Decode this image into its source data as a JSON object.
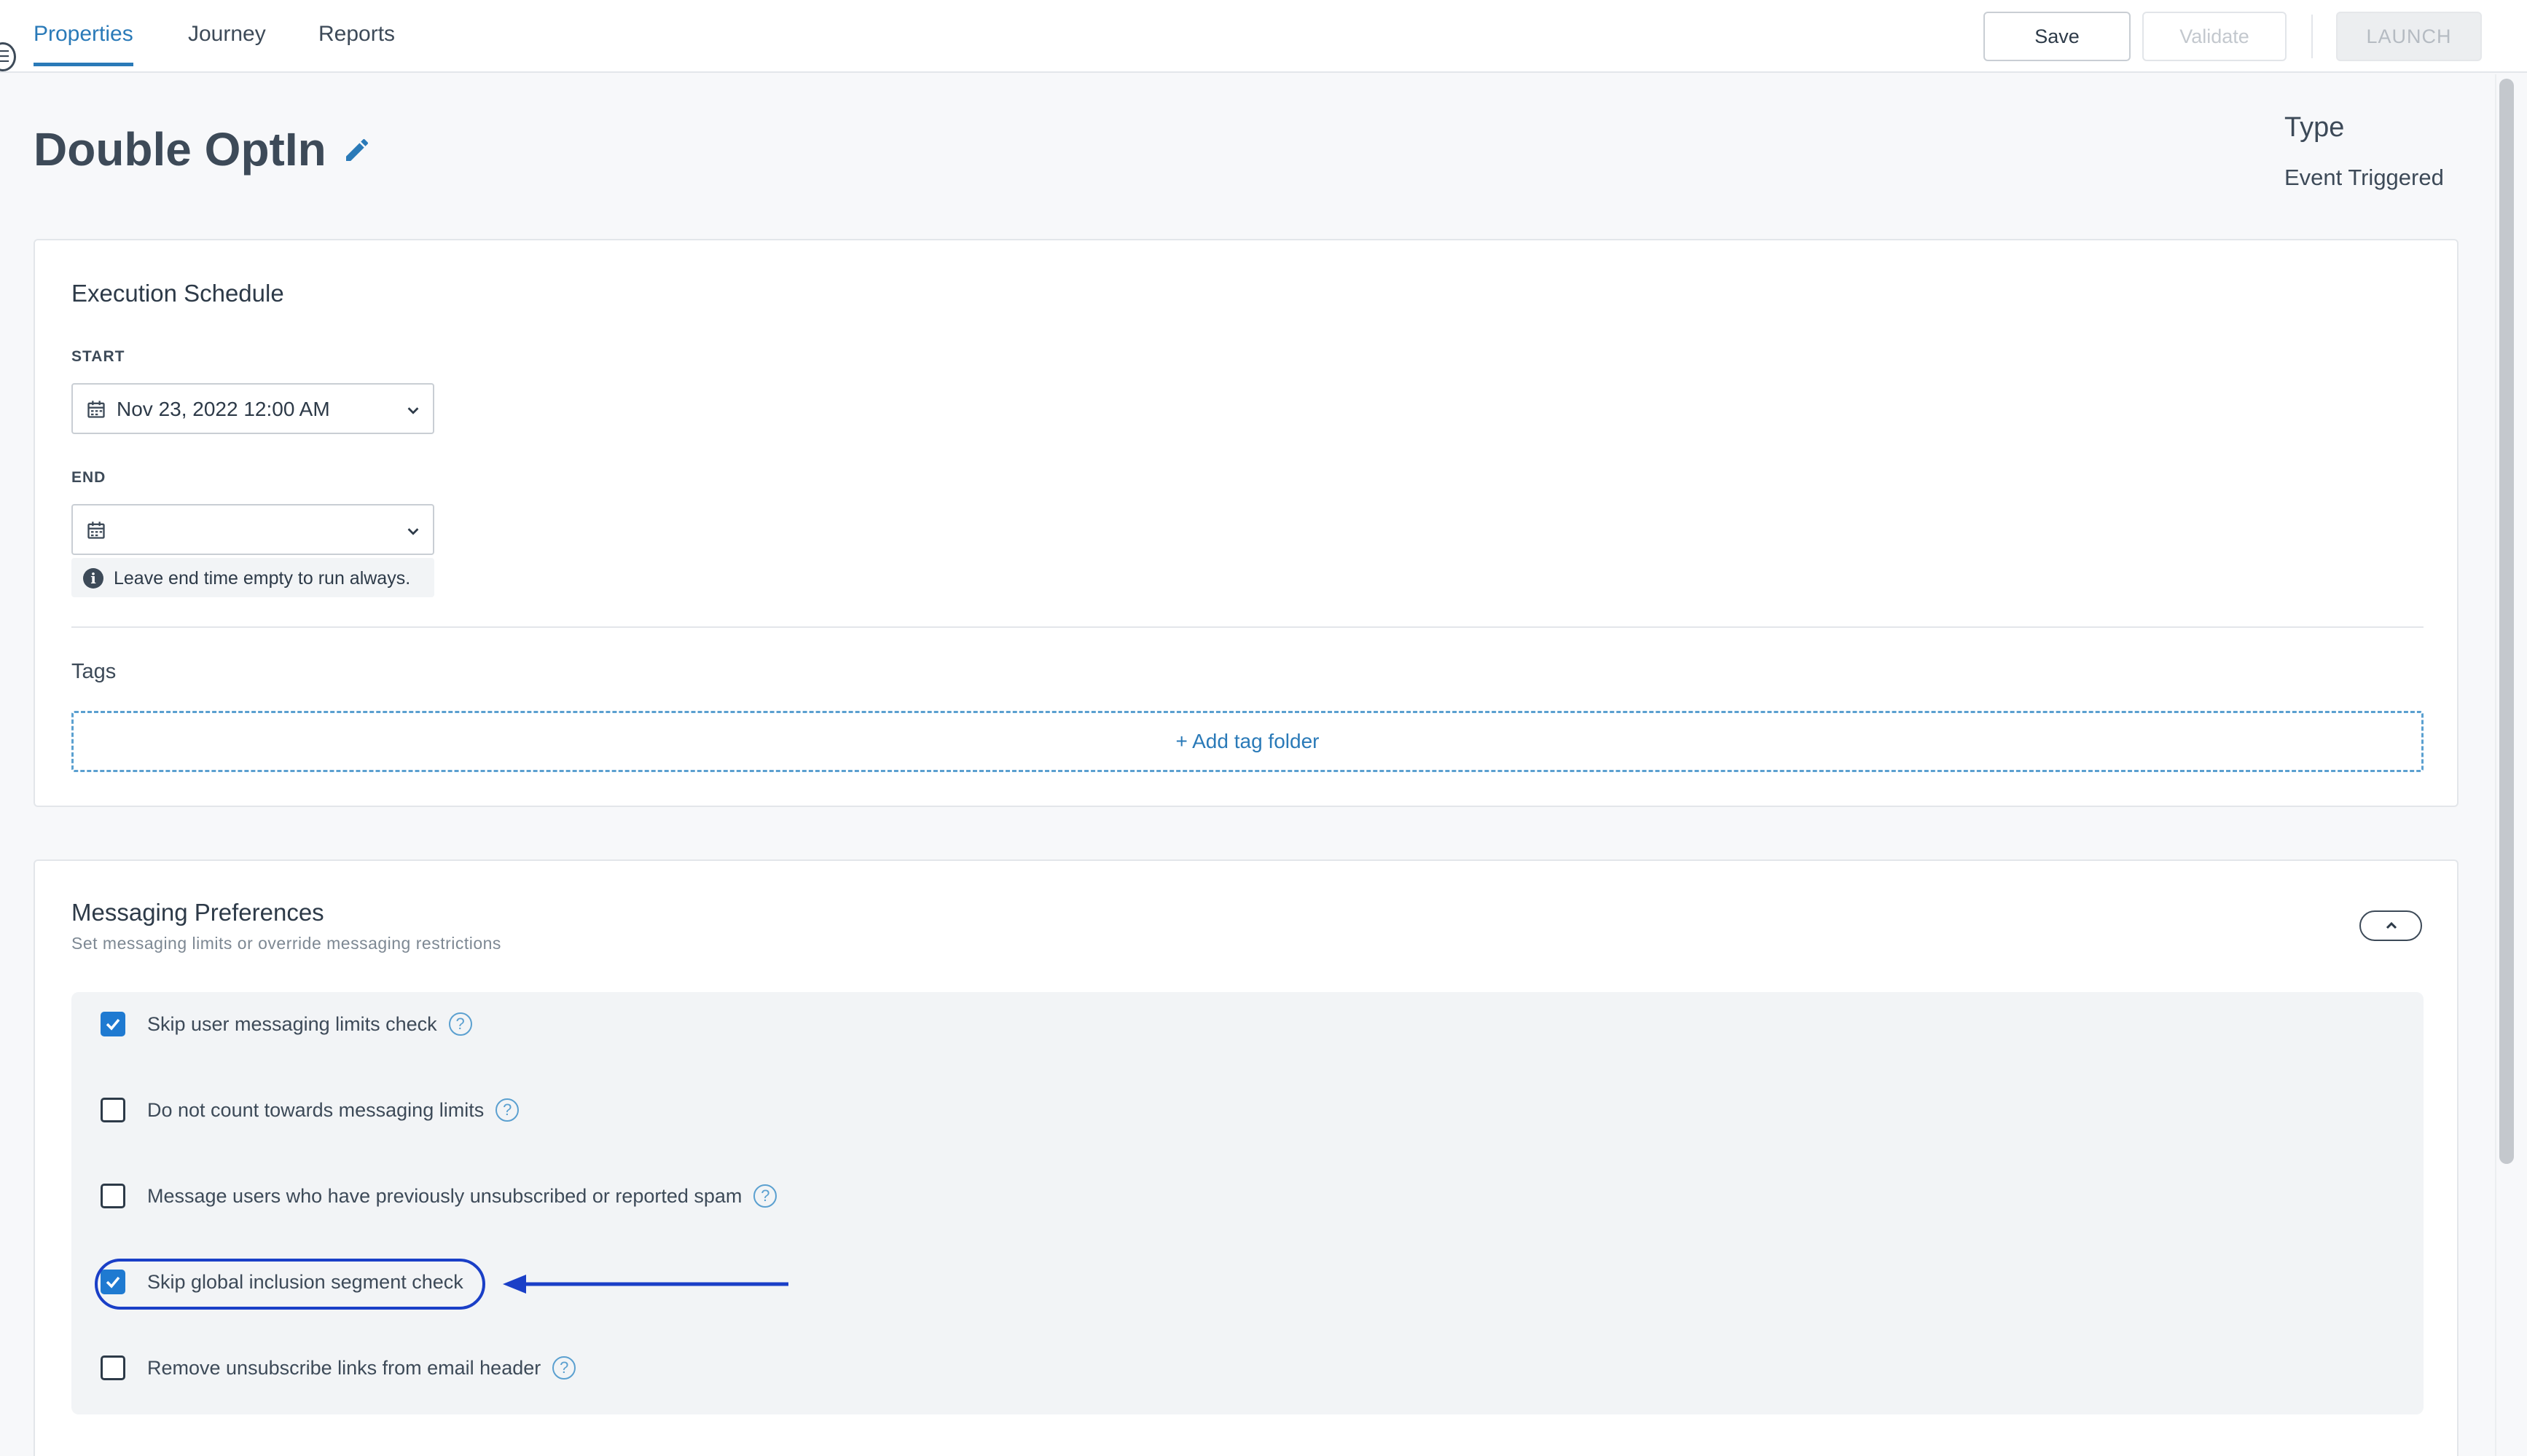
{
  "tabs": [
    {
      "label": "Properties",
      "active": true
    },
    {
      "label": "Journey",
      "active": false
    },
    {
      "label": "Reports",
      "active": false
    }
  ],
  "actions": {
    "save_label": "Save",
    "validate_label": "Validate",
    "launch_label": "LAUNCH"
  },
  "header": {
    "title": "Double OptIn",
    "type_label": "Type",
    "type_value": "Event Triggered"
  },
  "execution_schedule": {
    "title": "Execution Schedule",
    "start_label": "START",
    "start_value": "Nov 23, 2022 12:00 AM",
    "end_label": "END",
    "end_value": "",
    "end_hint": "Leave end time empty to run always."
  },
  "tags": {
    "label": "Tags",
    "add_label": "+ Add tag folder"
  },
  "messaging": {
    "title": "Messaging Preferences",
    "subtitle": "Set messaging limits or override messaging restrictions",
    "options": [
      {
        "label": "Skip user messaging limits check",
        "checked": true,
        "help": true
      },
      {
        "label": "Do not count towards messaging limits",
        "checked": false,
        "help": true
      },
      {
        "label": "Message users who have previously unsubscribed or reported spam",
        "checked": false,
        "help": true
      },
      {
        "label": "Skip global inclusion segment check",
        "checked": true,
        "help": false
      },
      {
        "label": "Remove unsubscribe links from email header",
        "checked": false,
        "help": true
      }
    ]
  },
  "colors": {
    "accent": "#2a7ab8",
    "checkbox_checked": "#1f7ad1",
    "annotation": "#1a3fc7"
  },
  "icons": {
    "edit": "pencil-icon",
    "calendar": "calendar-icon",
    "info": "info-icon",
    "help": "question-circle-icon",
    "collapse": "chevron-up-icon"
  }
}
